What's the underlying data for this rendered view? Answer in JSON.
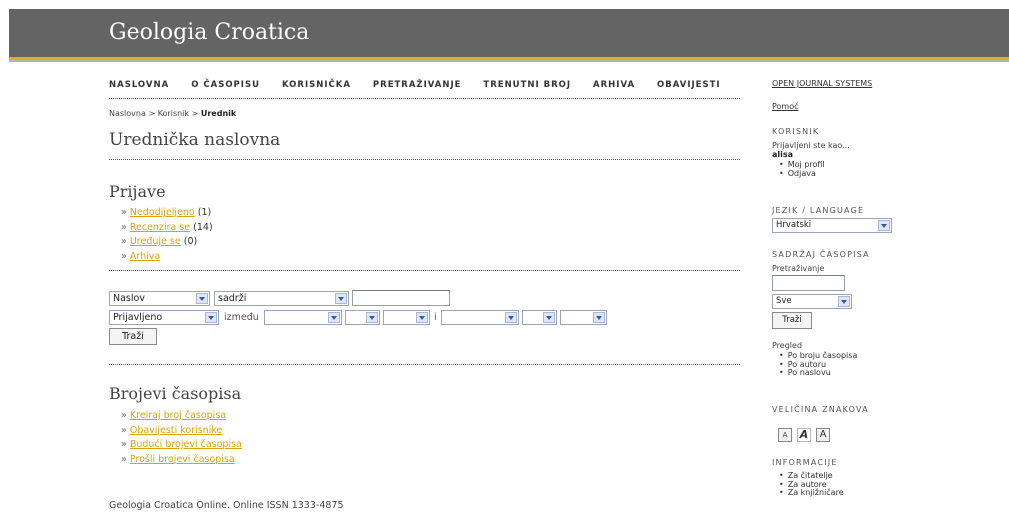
{
  "header": {
    "title": "Geologia Croatica"
  },
  "nav": [
    "NASLOVNA",
    "O ČASOPISU",
    "KORISNIČKA",
    "PRETRAŽIVANJE",
    "TRENUTNI BROJ",
    "ARHIVA",
    "OBAVIJESTI"
  ],
  "breadcrumb": {
    "home": "Naslovna",
    "sep1": ">",
    "user": "Korisnik",
    "sep2": ">",
    "current": "Urednik"
  },
  "page_title": "Urednička naslovna",
  "submissions": {
    "title": "Prijave",
    "items": [
      {
        "label": "Nedodijeljeno",
        "count": "(1)"
      },
      {
        "label": "Recenzira se",
        "count": "(14)"
      },
      {
        "label": "Uređuje se",
        "count": "(0)"
      },
      {
        "label": "Arhiva",
        "count": ""
      }
    ]
  },
  "search": {
    "field": "Naslov",
    "match": "sadrži",
    "date_field": "Prijavljeno",
    "between": "između",
    "and": "i",
    "button": "Traži"
  },
  "issues": {
    "title": "Brojevi časopisa",
    "items": [
      "Kreiraj broj časopisa",
      "Obavijesti korisnike",
      "Budući brojevi časopisa",
      "Prošli brojevi časopisa"
    ]
  },
  "footer": "Geologia Croatica Online. Online ISSN 1333-4875",
  "sidebar": {
    "ojs": "OPEN JOURNAL SYSTEMS",
    "help": "Pomoć",
    "user_head": "KORISNIK",
    "logged_as": "Prijavljeni ste kao...",
    "username": "alisa",
    "user_links": [
      "Moj profil",
      "Odjava"
    ],
    "lang_head": "JEZIK / LANGUAGE",
    "lang_value": "Hrvatski",
    "content_head": "SADRŽAJ ČASOPISA",
    "search_label": "Pretraživanje",
    "scope_value": "Sve",
    "search_button": "Traži",
    "browse_label": "Pregled",
    "browse_links": [
      "Po broju časopisa",
      "Po autoru",
      "Po naslovu"
    ],
    "font_head": "VELIČINA ZNAKOVA",
    "font_buttons": [
      "A",
      "A",
      "A"
    ],
    "info_head": "INFORMACIJE",
    "info_links": [
      "Za čitatelje",
      "Za autore",
      "Za knjižničare"
    ]
  }
}
